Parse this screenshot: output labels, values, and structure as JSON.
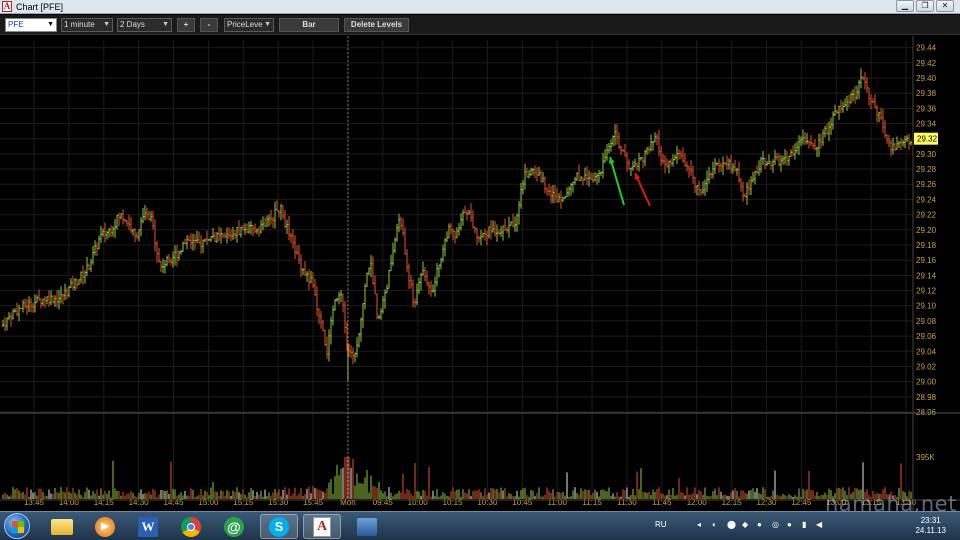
{
  "window": {
    "title": "Chart [PFE]"
  },
  "toolbar": {
    "symbol": "PFE",
    "interval": "1 minute",
    "range": "2 Days",
    "zoom_in": "+",
    "zoom_out": "-",
    "study": "PriceLeve",
    "bar_label": "Bar",
    "delete_levels_label": "Delete Levels"
  },
  "chart_data": {
    "type": "bar",
    "symbol": "PFE",
    "y_ticks": [
      "29.44",
      "29.42",
      "29.40",
      "29.38",
      "29.36",
      "29.34",
      "29.32",
      "29.30",
      "29.28",
      "29.26",
      "29.24",
      "29.22",
      "29.20",
      "29.18",
      "29.16",
      "29.14",
      "29.12",
      "29.10",
      "29.08",
      "29.06",
      "29.04",
      "29.02",
      "29.00",
      "28.98",
      "28.96"
    ],
    "ylim": [
      28.96,
      29.45
    ],
    "last_price": "29.32",
    "volume_tick": "395K",
    "x_ticks": [
      "13:45",
      "14:00",
      "14:15",
      "14:30",
      "14:45",
      "15:00",
      "15:15",
      "15:30",
      "15:45",
      "Mon",
      "09:45",
      "10:00",
      "10:15",
      "10:30",
      "10:45",
      "11:00",
      "11:15",
      "11:30",
      "11:45",
      "12:00",
      "12:15",
      "12:30",
      "12:45",
      "13:00",
      "13:15",
      "13:30"
    ],
    "session_break_label": "Mon",
    "price_path": [
      [
        0,
        29.07
      ],
      [
        12,
        29.09
      ],
      [
        25,
        29.1
      ],
      [
        45,
        29.11
      ],
      [
        60,
        29.11
      ],
      [
        75,
        29.13
      ],
      [
        88,
        29.15
      ],
      [
        100,
        29.19
      ],
      [
        110,
        29.2
      ],
      [
        120,
        29.22
      ],
      [
        128,
        29.21
      ],
      [
        135,
        29.19
      ],
      [
        145,
        29.22
      ],
      [
        152,
        29.21
      ],
      [
        160,
        29.15
      ],
      [
        168,
        29.16
      ],
      [
        178,
        29.17
      ],
      [
        188,
        29.19
      ],
      [
        198,
        29.18
      ],
      [
        210,
        29.19
      ],
      [
        225,
        29.19
      ],
      [
        240,
        29.2
      ],
      [
        255,
        29.2
      ],
      [
        268,
        29.21
      ],
      [
        280,
        29.23
      ],
      [
        290,
        29.19
      ],
      [
        302,
        29.15
      ],
      [
        312,
        29.13
      ],
      [
        320,
        29.08
      ],
      [
        327,
        29.04
      ],
      [
        334,
        29.1
      ],
      [
        341,
        29.12
      ],
      [
        348,
        29.04
      ],
      [
        352,
        29.03
      ],
      [
        358,
        29.05
      ],
      [
        364,
        29.12
      ],
      [
        370,
        29.16
      ],
      [
        378,
        29.08
      ],
      [
        386,
        29.12
      ],
      [
        394,
        29.18
      ],
      [
        400,
        29.22
      ],
      [
        406,
        29.16
      ],
      [
        414,
        29.1
      ],
      [
        422,
        29.15
      ],
      [
        432,
        29.12
      ],
      [
        440,
        29.16
      ],
      [
        448,
        29.2
      ],
      [
        456,
        29.19
      ],
      [
        466,
        29.23
      ],
      [
        478,
        29.19
      ],
      [
        490,
        29.2
      ],
      [
        505,
        29.2
      ],
      [
        515,
        29.21
      ],
      [
        524,
        29.27
      ],
      [
        534,
        29.28
      ],
      [
        545,
        29.26
      ],
      [
        556,
        29.24
      ],
      [
        566,
        29.25
      ],
      [
        576,
        29.27
      ],
      [
        588,
        29.27
      ],
      [
        600,
        29.27
      ],
      [
        608,
        29.31
      ],
      [
        615,
        29.33
      ],
      [
        622,
        29.3
      ],
      [
        630,
        29.28
      ],
      [
        638,
        29.29
      ],
      [
        646,
        29.3
      ],
      [
        656,
        29.32
      ],
      [
        664,
        29.28
      ],
      [
        672,
        29.29
      ],
      [
        680,
        29.3
      ],
      [
        688,
        29.28
      ],
      [
        700,
        29.25
      ],
      [
        712,
        29.28
      ],
      [
        724,
        29.29
      ],
      [
        736,
        29.28
      ],
      [
        744,
        29.24
      ],
      [
        752,
        29.27
      ],
      [
        762,
        29.29
      ],
      [
        774,
        29.29
      ],
      [
        786,
        29.29
      ],
      [
        796,
        29.31
      ],
      [
        806,
        29.32
      ],
      [
        816,
        29.31
      ],
      [
        826,
        29.33
      ],
      [
        838,
        29.36
      ],
      [
        848,
        29.37
      ],
      [
        856,
        29.38
      ],
      [
        862,
        29.4
      ],
      [
        870,
        29.37
      ],
      [
        880,
        29.35
      ],
      [
        888,
        29.31
      ],
      [
        896,
        29.31
      ],
      [
        904,
        29.32
      ],
      [
        912,
        29.31
      ]
    ],
    "annotations": [
      {
        "type": "arrow",
        "color": "green",
        "direction": "up"
      },
      {
        "type": "arrow",
        "color": "red",
        "direction": "up"
      }
    ]
  },
  "taskbar": {
    "language": "RU",
    "time": "23:31",
    "date": "24.11.13"
  },
  "watermark": "namaha.net",
  "colors": {
    "up": "#8fc83e",
    "down": "#e0532a",
    "axis_text": "#c9a23a",
    "grid": "#1c1c1c",
    "price_box": "#ffff66",
    "volume_white": "#e8e8e8"
  }
}
